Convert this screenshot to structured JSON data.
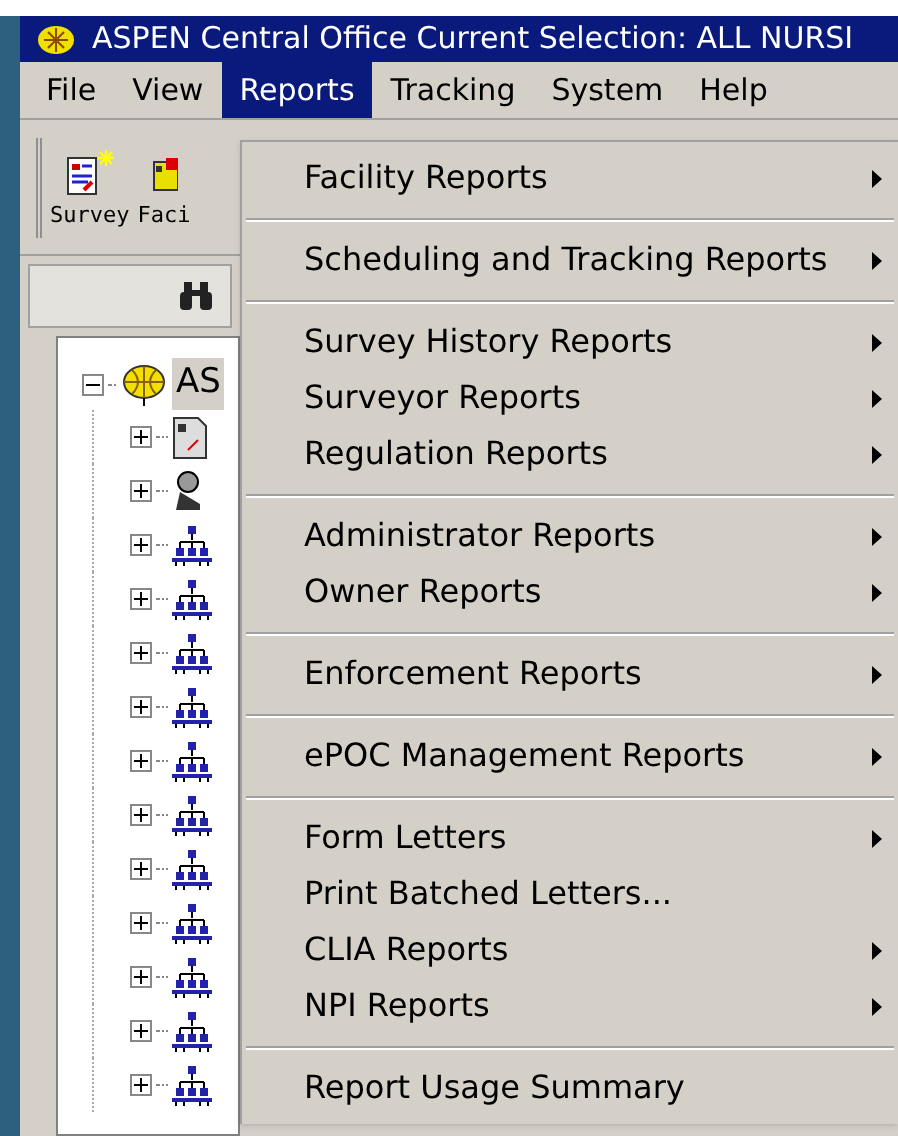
{
  "window": {
    "title": "ASPEN Central Office Current Selection: ALL NURSI"
  },
  "menubar": [
    {
      "label": "File",
      "selected": false
    },
    {
      "label": "View",
      "selected": false
    },
    {
      "label": "Reports",
      "selected": true
    },
    {
      "label": "Tracking",
      "selected": false
    },
    {
      "label": "System",
      "selected": false
    },
    {
      "label": "Help",
      "selected": false
    }
  ],
  "toolbar": [
    {
      "label": "Survey",
      "kind": "survey"
    },
    {
      "label": "Faci",
      "kind": "facility"
    }
  ],
  "tree": {
    "label": "AS",
    "expanded": true,
    "children": [
      {
        "kind": "document",
        "expanded": false
      },
      {
        "kind": "person",
        "expanded": false
      },
      {
        "kind": "hierarchy",
        "expanded": false
      },
      {
        "kind": "hierarchy",
        "expanded": false
      },
      {
        "kind": "hierarchy",
        "expanded": false
      },
      {
        "kind": "hierarchy",
        "expanded": false
      },
      {
        "kind": "hierarchy",
        "expanded": false
      },
      {
        "kind": "hierarchy",
        "expanded": false
      },
      {
        "kind": "hierarchy",
        "expanded": false
      },
      {
        "kind": "hierarchy",
        "expanded": false
      },
      {
        "kind": "hierarchy",
        "expanded": false
      },
      {
        "kind": "hierarchy",
        "expanded": false
      },
      {
        "kind": "hierarchy",
        "expanded": false
      }
    ]
  },
  "menu": [
    {
      "kind": "item",
      "label": "Facility Reports",
      "submenu": true
    },
    {
      "kind": "separator"
    },
    {
      "kind": "item",
      "label": "Scheduling and Tracking Reports",
      "submenu": true
    },
    {
      "kind": "separator"
    },
    {
      "kind": "item",
      "label": "Survey History Reports",
      "submenu": true
    },
    {
      "kind": "item",
      "label": "Surveyor Reports",
      "submenu": true
    },
    {
      "kind": "item",
      "label": "Regulation Reports",
      "submenu": true
    },
    {
      "kind": "separator"
    },
    {
      "kind": "item",
      "label": "Administrator Reports",
      "submenu": true
    },
    {
      "kind": "item",
      "label": "Owner Reports",
      "submenu": true
    },
    {
      "kind": "separator"
    },
    {
      "kind": "item",
      "label": "Enforcement Reports",
      "submenu": true
    },
    {
      "kind": "separator"
    },
    {
      "kind": "item",
      "label": "ePOC Management Reports",
      "submenu": true
    },
    {
      "kind": "separator"
    },
    {
      "kind": "item",
      "label": "Form Letters",
      "submenu": true
    },
    {
      "kind": "item",
      "label": "Print Batched Letters...",
      "submenu": false
    },
    {
      "kind": "item",
      "label": "CLIA Reports",
      "submenu": true
    },
    {
      "kind": "item",
      "label": "NPI Reports",
      "submenu": true
    },
    {
      "kind": "separator"
    },
    {
      "kind": "item",
      "label": "Report Usage Summary",
      "submenu": false
    }
  ]
}
